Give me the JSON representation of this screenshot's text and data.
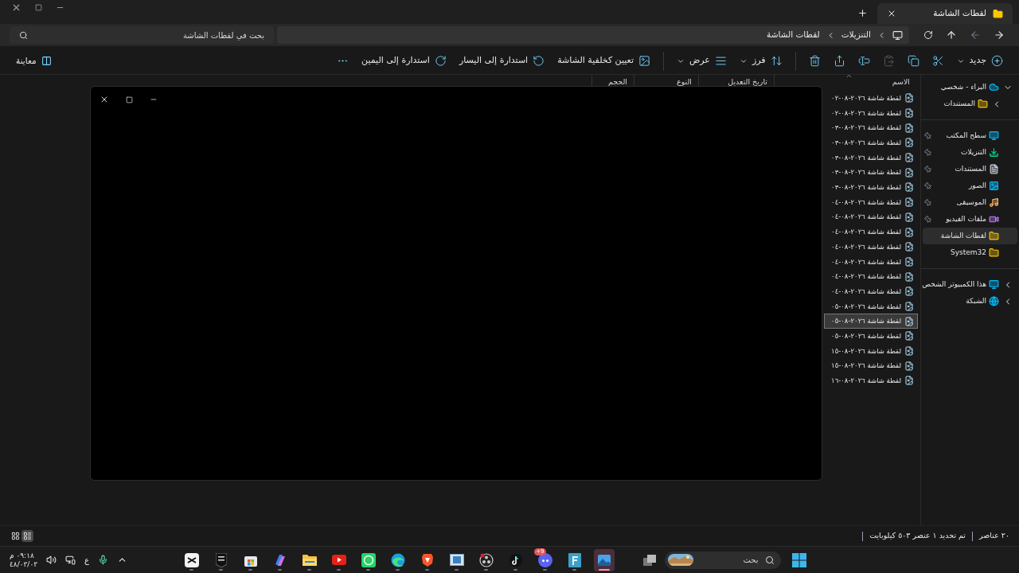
{
  "tabs": [
    {
      "label": "لقطات الشاشة",
      "selected": true
    }
  ],
  "address": {
    "breadcrumbs": [
      "التنزيلات",
      "لقطات الشاشة"
    ]
  },
  "search": {
    "placeholder": "بحث في لقطات الشاشة"
  },
  "toolbar": [
    {
      "kind": "new",
      "label": "جديد",
      "disabled": false
    },
    {
      "kind": "cut",
      "disabled": false
    },
    {
      "kind": "copy",
      "disabled": false
    },
    {
      "kind": "paste",
      "disabled": true
    },
    {
      "kind": "rename",
      "disabled": false
    },
    {
      "kind": "share",
      "disabled": false
    },
    {
      "kind": "delete",
      "disabled": false
    },
    {
      "kind": "separator"
    },
    {
      "kind": "sort",
      "label": "فرز",
      "disabled": false
    },
    {
      "kind": "view",
      "label": "عرض",
      "disabled": false
    },
    {
      "kind": "separator"
    },
    {
      "kind": "wallpaper",
      "label": "تعيين كخلفية الشاشة",
      "disabled": false
    },
    {
      "kind": "rotate_left",
      "label": "استدارة إلى اليسار",
      "disabled": false
    },
    {
      "kind": "rotate_right",
      "label": "استدارة إلى اليمين",
      "disabled": false
    },
    {
      "kind": "more",
      "disabled": false
    }
  ],
  "preview_button": "معاينة",
  "columns": [
    {
      "label": "الاسم",
      "sorted": true
    },
    {
      "label": "تاريخ التعديل",
      "sorted": false
    },
    {
      "label": "النوع",
      "sorted": false
    },
    {
      "label": "الحجم",
      "sorted": false
    }
  ],
  "files": [
    {
      "name": "لقطة شاشة ٢٠٢٦-٠٨-٠٢",
      "selected": false
    },
    {
      "name": "لقطة شاشة ٢٠٢٦-٠٨-٠٢",
      "selected": false
    },
    {
      "name": "لقطة شاشة ٢٠٢٦-٠٨-٠٣",
      "selected": false
    },
    {
      "name": "لقطة شاشة ٢٠٢٦-٠٨-٠٣",
      "selected": false
    },
    {
      "name": "لقطة شاشة ٢٠٢٦-٠٨-٠٣",
      "selected": false
    },
    {
      "name": "لقطة شاشة ٢٠٢٦-٠٨-٠٣",
      "selected": false
    },
    {
      "name": "لقطة شاشة ٢٠٢٦-٠٨-٠٣",
      "selected": false
    },
    {
      "name": "لقطة شاشة ٢٠٢٦-٠٨-٠٤",
      "selected": false
    },
    {
      "name": "لقطة شاشة ٢٠٢٦-٠٨-٠٤",
      "selected": false
    },
    {
      "name": "لقطة شاشة ٢٠٢٦-٠٨-٠٤",
      "selected": false
    },
    {
      "name": "لقطة شاشة ٢٠٢٦-٠٨-٠٤",
      "selected": false
    },
    {
      "name": "لقطة شاشة ٢٠٢٦-٠٨-٠٤",
      "selected": false
    },
    {
      "name": "لقطة شاشة ٢٠٢٦-٠٨-٠٤",
      "selected": false
    },
    {
      "name": "لقطة شاشة ٢٠٢٦-٠٨-٠٤",
      "selected": false
    },
    {
      "name": "لقطة شاشة ٢٠٢٦-٠٨-٠٥",
      "selected": false
    },
    {
      "name": "لقطة شاشة ٢٠٢٦-٠٨-٠٥",
      "selected": true
    },
    {
      "name": "لقطة شاشة ٢٠٢٦-٠٨-٠٥",
      "selected": false
    },
    {
      "name": "لقطة شاشة ٢٠٢٦-٠٨-١٥",
      "selected": false
    },
    {
      "name": "لقطة شاشة ٢٠٢٦-٠٨-١٥",
      "selected": false
    },
    {
      "name": "لقطة شاشة ٢٠٢٦-٠٨-١٦",
      "selected": false
    }
  ],
  "sidebar": [
    [
      {
        "label": "البراء - شخصي",
        "kind": "cloud",
        "expanded": true,
        "pinned": false,
        "selected": false,
        "children": [
          {
            "label": "المستندات",
            "kind": "folder",
            "expanded": false,
            "pinned": false,
            "selected": false
          }
        ]
      }
    ],
    [
      {
        "label": "سطح المكتب",
        "kind": "desktop",
        "pinned": true,
        "selected": false
      },
      {
        "label": "التنزيلات",
        "kind": "downloads",
        "pinned": true,
        "selected": false
      },
      {
        "label": "المستندات",
        "kind": "documents",
        "pinned": true,
        "selected": false
      },
      {
        "label": "الصور",
        "kind": "pictures",
        "pinned": true,
        "selected": false
      },
      {
        "label": "الموسيقى",
        "kind": "music",
        "pinned": true,
        "selected": false
      },
      {
        "label": "ملفات الفيديو",
        "kind": "videos",
        "pinned": true,
        "selected": false
      },
      {
        "label": "لقطات الشاشة",
        "kind": "folder",
        "pinned": false,
        "selected": true
      },
      {
        "label": "System32",
        "kind": "folder",
        "pinned": false,
        "selected": false
      }
    ],
    [
      {
        "label": "هذا الكمبيوتر الشخص",
        "kind": "pc",
        "expanded": false,
        "pinned": false,
        "selected": false
      },
      {
        "label": "الشبكة",
        "kind": "network",
        "expanded": false,
        "pinned": false,
        "selected": false
      }
    ]
  ],
  "status_bar": {
    "count": "٢٠ عناصر",
    "selection": "تم تحديد ١ عنصر ٥٠٣ كيلوبايت"
  },
  "views": [
    {
      "kind": "details",
      "selected": true
    },
    {
      "kind": "tiles",
      "selected": false
    }
  ],
  "taskbar": {
    "search_placeholder": "بحث",
    "apps": [
      {
        "kind": "photos",
        "active": true
      },
      {
        "kind": "f-app",
        "active": false
      },
      {
        "kind": "discord",
        "active": false,
        "badge": "9+"
      },
      {
        "kind": "tiktok",
        "active": false
      },
      {
        "kind": "obs",
        "active": false
      },
      {
        "kind": "window-app",
        "active": false
      },
      {
        "kind": "brave",
        "active": false
      },
      {
        "kind": "edge",
        "active": false
      },
      {
        "kind": "whatsapp",
        "active": false
      },
      {
        "kind": "youtube",
        "active": false
      },
      {
        "kind": "explorer",
        "active": false
      },
      {
        "kind": "copilot",
        "active": false
      },
      {
        "kind": "store",
        "active": false
      },
      {
        "kind": "epic",
        "active": false
      },
      {
        "kind": "capcut",
        "active": false
      }
    ],
    "language": "ع",
    "time": "٠٩:١٨ م",
    "date": "٤٨/٠٣/٠٣"
  }
}
